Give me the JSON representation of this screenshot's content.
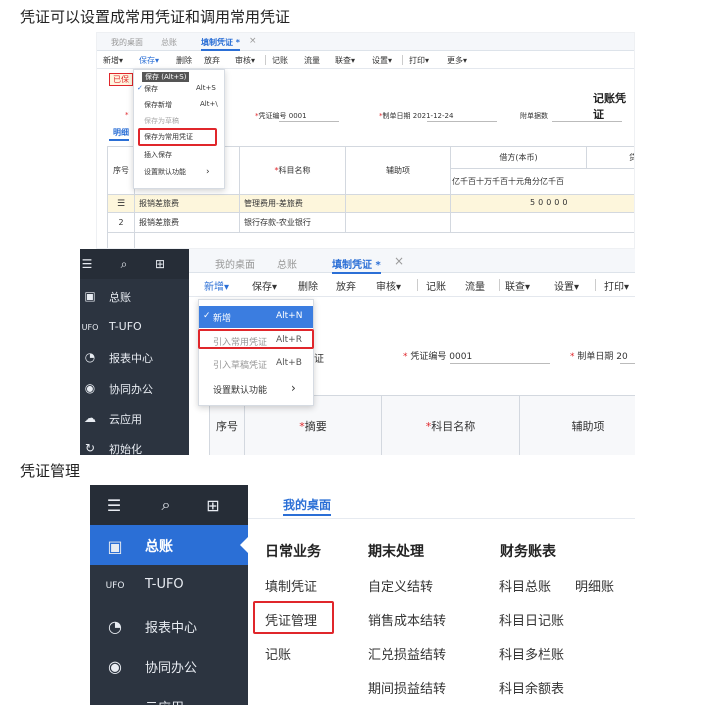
{
  "caption1": "凭证可以设置成常用凭证和调用常用凭证",
  "caption2": "凭证管理",
  "shot1": {
    "tabs": [
      "我的桌面",
      "总账",
      "填制凭证 *"
    ],
    "tab_close": "×",
    "toolbar": [
      "新增",
      "保存",
      "删除",
      "放弃",
      "审核",
      "记账",
      "流量",
      "联查",
      "设置",
      "打印",
      "更多"
    ],
    "save_tooltip": "保存 (Alt+S)",
    "save_menu": [
      {
        "label": "保存",
        "key": "Alt+S"
      },
      {
        "label": "保存新增",
        "key": "Alt+\\"
      },
      {
        "label": "保存为草稿",
        "key": ""
      },
      {
        "label": "保存为常用凭证",
        "key": ""
      },
      {
        "label": "插入保存",
        "key": ""
      },
      {
        "label": "设置默认功能",
        "key": "›"
      }
    ],
    "status_stamp": "已保",
    "form_title": "记账凭证",
    "fields": {
      "voucher_no_label": "凭证编号",
      "voucher_no": "0001",
      "date_label": "制单日期",
      "date": "2021-12-24",
      "attach_label": "附单据数"
    },
    "detail_tab": "明细",
    "headers": {
      "seq": "序号",
      "subject": "科目名称",
      "aux": "辅助项",
      "debit": "借方(本币)",
      "credit": "贷"
    },
    "digits": [
      "亿",
      "千",
      "百",
      "十",
      "万",
      "千",
      "百",
      "十",
      "元",
      "角",
      "分"
    ],
    "digits_credit": [
      "亿",
      "千",
      "百"
    ],
    "rows": [
      {
        "seq": "☰",
        "summary": "报销差旅费",
        "subject": "管理费用-差旅费",
        "amount": [
          "5",
          "0",
          "0",
          "0",
          "0"
        ]
      },
      {
        "seq": "2",
        "summary": "报销差旅费",
        "subject": "银行存款-农业银行",
        "amount": []
      }
    ]
  },
  "shot2": {
    "sidebar": [
      "总账",
      "T-UFO",
      "报表中心",
      "协同办公",
      "云应用",
      "初始化"
    ],
    "tabs": [
      "我的桌面",
      "总账",
      "填制凭证 *"
    ],
    "tab_close": "×",
    "toolbar": [
      "新增",
      "保存",
      "删除",
      "放弃",
      "审核",
      "记账",
      "流量",
      "联查",
      "设置",
      "打印"
    ],
    "new_menu": [
      {
        "label": "新增",
        "key": "Alt+N"
      },
      {
        "label": "引入常用凭证",
        "key": "Alt+R"
      },
      {
        "label": "引入草稿凭证",
        "key": "Alt+B"
      },
      {
        "label": "设置默认功能",
        "key": "›"
      }
    ],
    "fields": {
      "voucher_no_label": "凭证编号",
      "voucher_no": "0001",
      "date_label": "制单日期",
      "date_part": "20",
      "partial": "证"
    },
    "headers": {
      "seq": "序号",
      "summary": "摘要",
      "subject": "科目名称",
      "aux": "辅助项"
    }
  },
  "shot3": {
    "sidebar": [
      "总账",
      "T-UFO",
      "报表中心",
      "协同办公",
      "云应用"
    ],
    "tab": "我的桌面",
    "columns": [
      {
        "title": "日常业务",
        "items": [
          "填制凭证",
          "凭证管理",
          "记账"
        ]
      },
      {
        "title": "期末处理",
        "items": [
          "自定义结转",
          "销售成本结转",
          "汇兑损益结转",
          "期间损益结转"
        ]
      },
      {
        "title": "财务账表",
        "items": [
          "科目总账",
          "科目日记账",
          "科目多栏账",
          "科目余额表"
        ]
      }
    ],
    "extra_item": "明细账"
  },
  "colors": {
    "accent": "#2b6fd6",
    "sidebar_bg": "#2c3440",
    "highlight_red": "#e0262b",
    "active_menu": "#3b7de0"
  }
}
